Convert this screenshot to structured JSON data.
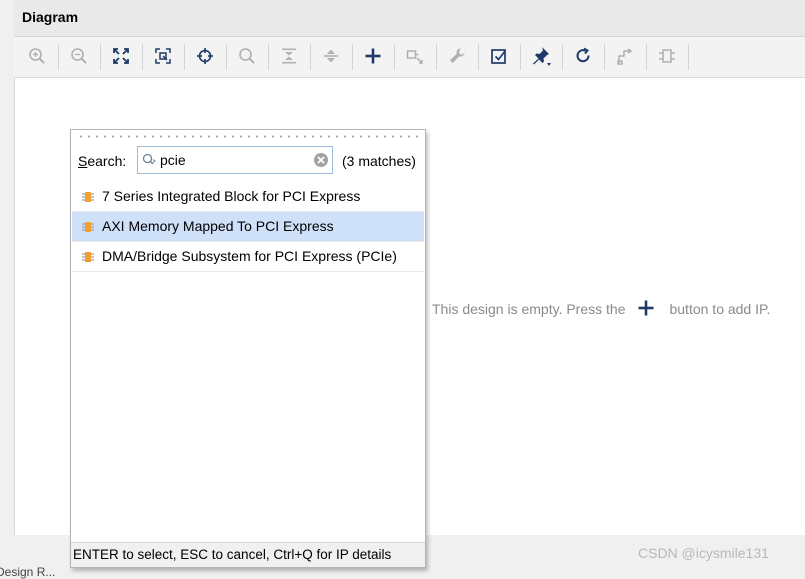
{
  "panel": {
    "title": "Diagram"
  },
  "toolbar": {
    "buttons": [
      {
        "icon": "zoom-in-icon"
      },
      {
        "icon": "zoom-out-icon"
      },
      {
        "icon": "zoom-fit-icon"
      },
      {
        "icon": "zoom-selection-icon"
      },
      {
        "icon": "auto-fit-target-icon"
      },
      {
        "icon": "search-icon"
      },
      {
        "icon": "collapse-all-icon"
      },
      {
        "icon": "expand-all-icon"
      },
      {
        "icon": "add-ip-icon"
      },
      {
        "icon": "make-connection-icon"
      },
      {
        "icon": "wrench-icon"
      },
      {
        "icon": "validate-design-icon"
      },
      {
        "icon": "pin-icon"
      },
      {
        "icon": "regenerate-layout-icon"
      },
      {
        "icon": "optimize-routing-icon"
      },
      {
        "icon": "interface-icon"
      }
    ]
  },
  "canvas": {
    "empty_message_before": "This design is empty. Press the",
    "empty_message_after": "button to add IP."
  },
  "popup": {
    "search_label_access": "S",
    "search_label_rest": "earch:",
    "search_value": "pcie",
    "match_count": "(3 matches)",
    "results": [
      {
        "label": "7 Series Integrated Block for PCI Express",
        "selected": false
      },
      {
        "label": "AXI Memory Mapped To PCI Express",
        "selected": true
      },
      {
        "label": "DMA/Bridge Subsystem for PCI Express (PCIe)",
        "selected": false
      }
    ],
    "footer": "ENTER to select, ESC to cancel, Ctrl+Q for IP details"
  },
  "bottom": {
    "tab_label": "Design R..."
  },
  "watermark": "CSDN @icysmile131",
  "colors": {
    "accent": "#1f3a68",
    "selection": "#cfe0f9",
    "icon_gray": "#b0b0b0",
    "chip_orange": "#f0a030"
  }
}
